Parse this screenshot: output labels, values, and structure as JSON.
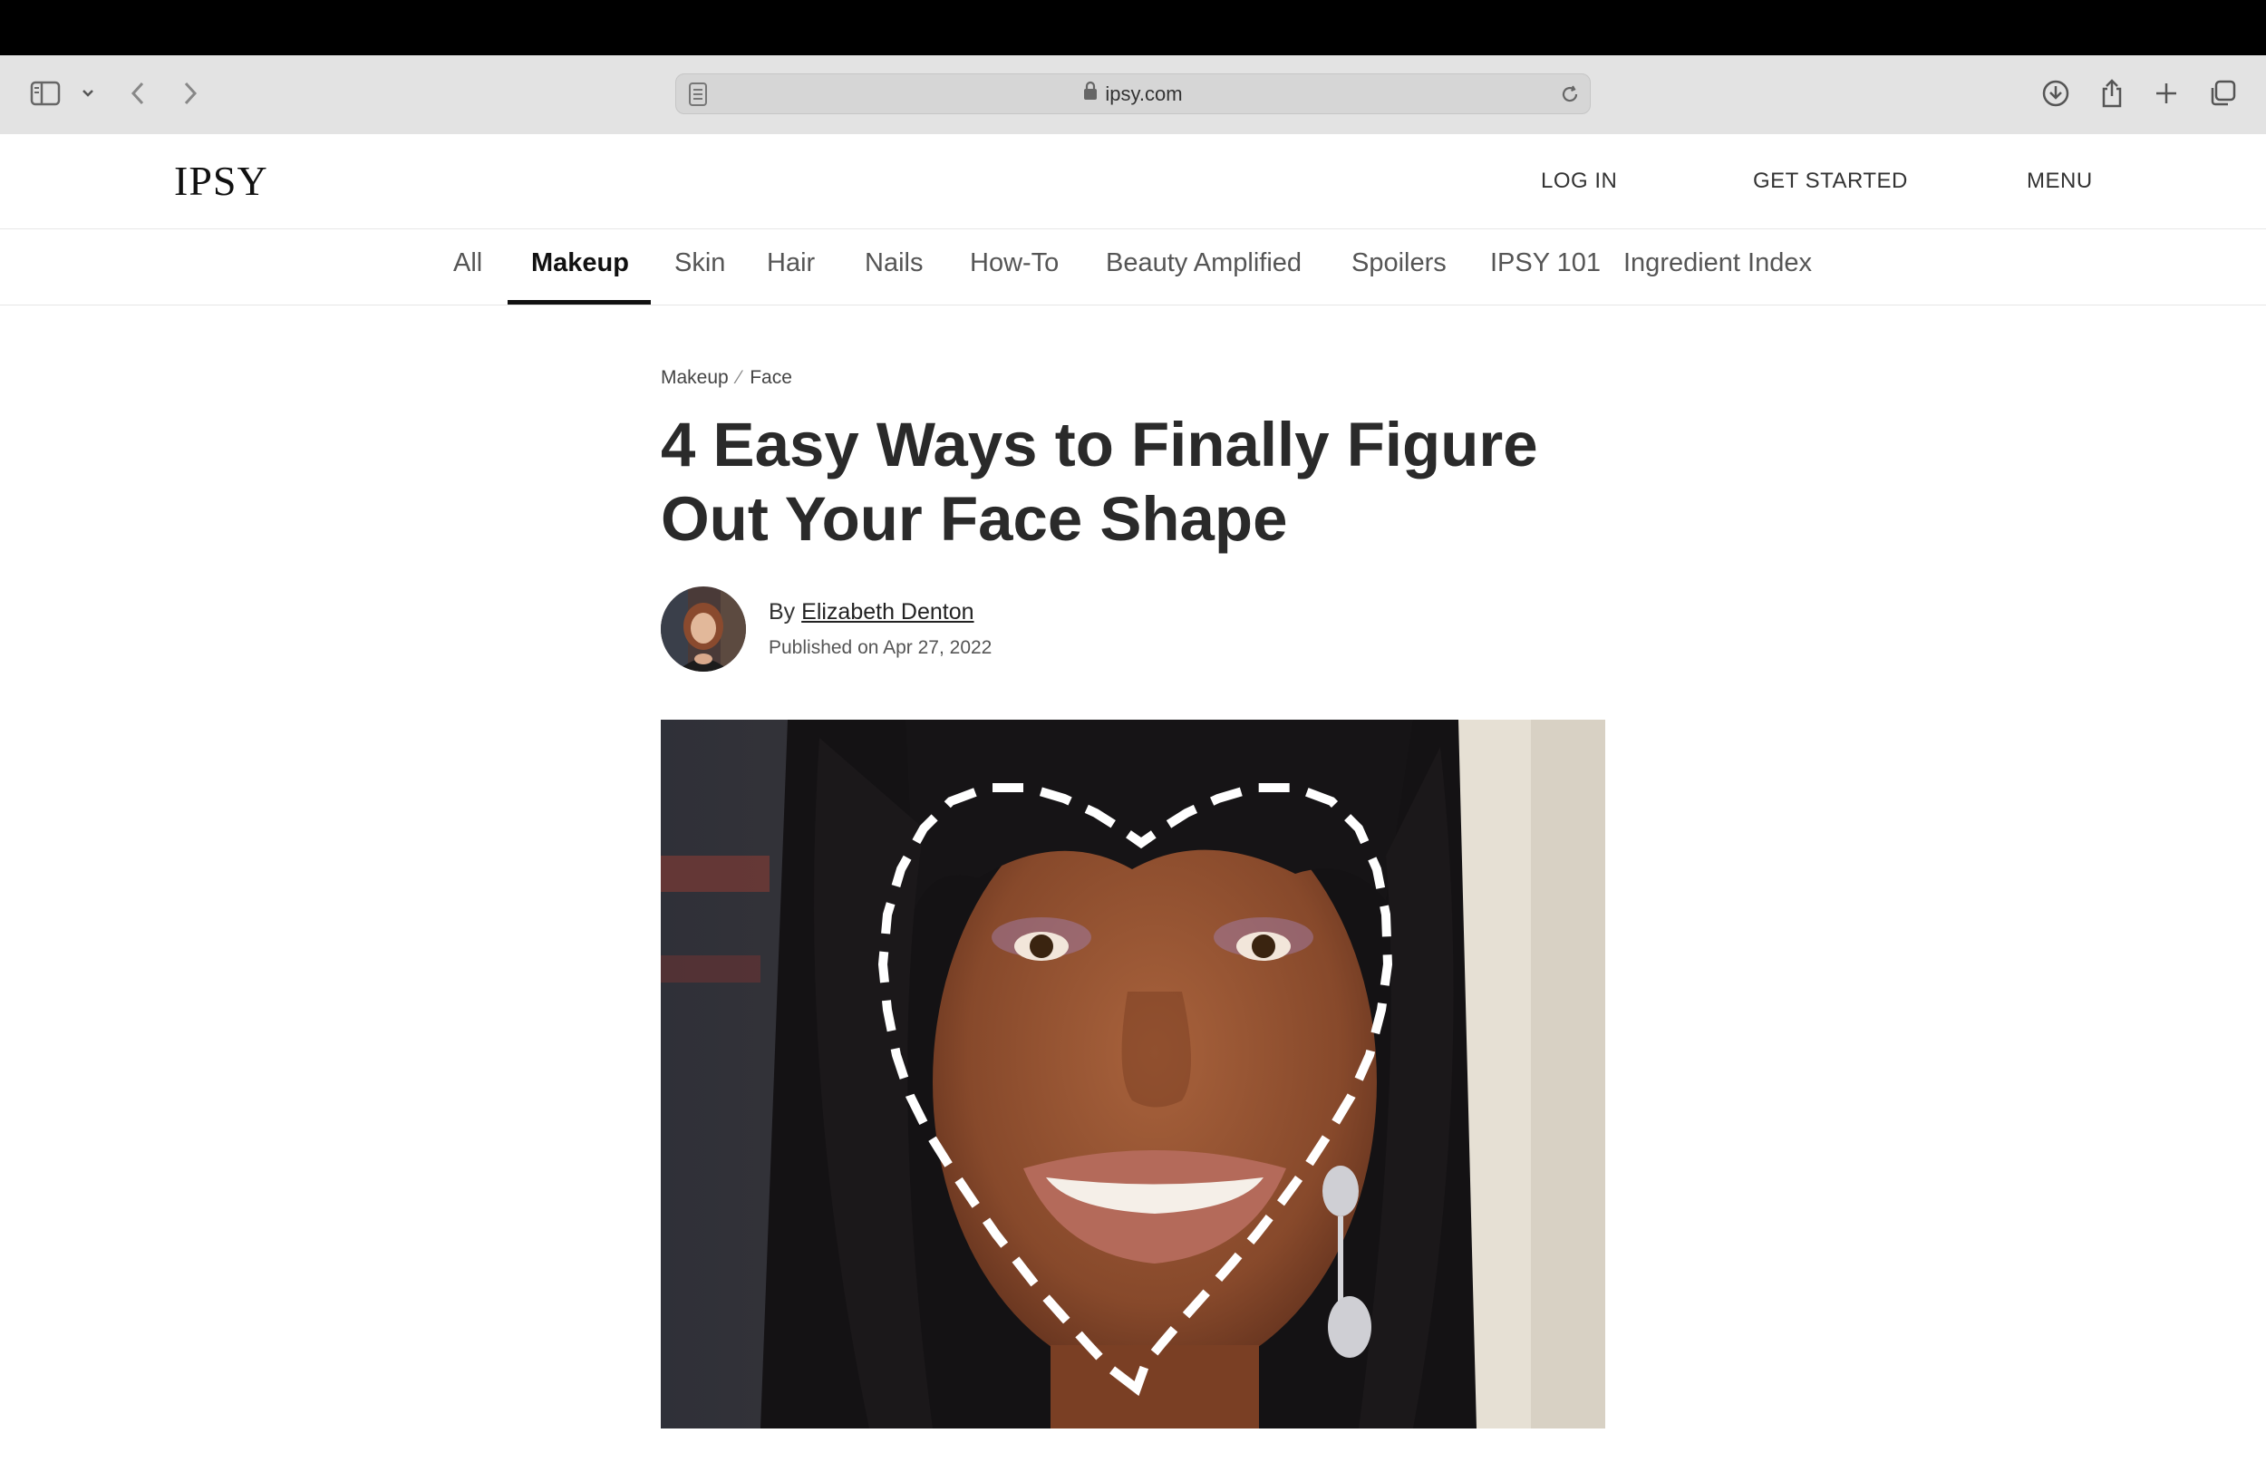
{
  "browser": {
    "url": "ipsy.com",
    "icons": [
      "sidebar-icon",
      "chevron-down-icon",
      "back-icon",
      "forward-icon",
      "reader-icon",
      "lock-icon",
      "reload-icon",
      "download-icon",
      "share-icon",
      "new-tab-icon",
      "tabs-overview-icon"
    ]
  },
  "header": {
    "logo": "IPSY",
    "login": "LOG IN",
    "get_started": "GET STARTED",
    "menu": "MENU"
  },
  "categories": [
    "All",
    "Makeup",
    "Skin",
    "Hair",
    "Nails",
    "How-To",
    "Beauty Amplified",
    "Spoilers",
    "IPSY 101",
    "Ingredient Index"
  ],
  "active_category": "Makeup",
  "breadcrumb": {
    "parent": "Makeup",
    "sep": "⁄",
    "current": "Face"
  },
  "article": {
    "title": "4 Easy Ways to Finally Figure Out Your Face Shape",
    "by_prefix": "By",
    "author": "Elizabeth Denton",
    "published": "Published on Apr 27, 2022"
  },
  "colors": {
    "topbar": "#000000",
    "browser_chrome": "#e3e3e3",
    "text": "#2b2b2b",
    "accent": "#111111"
  }
}
